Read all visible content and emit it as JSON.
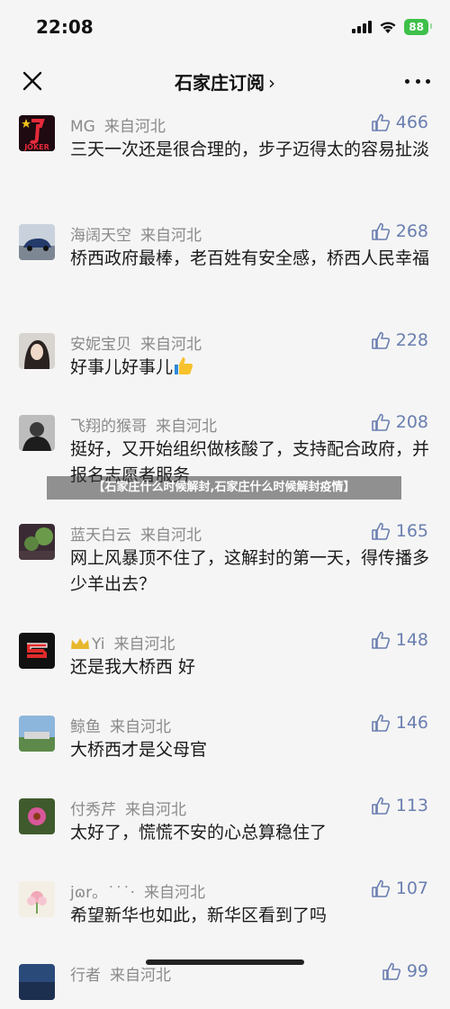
{
  "status_bar": {
    "time": "22:08",
    "battery": "88"
  },
  "navbar": {
    "title": "石家庄订阅",
    "chevron": "›"
  },
  "comments": [
    {
      "user": "MG",
      "location": "来自河北",
      "likes": "466",
      "text": "三天一次还是很合理的，步子迈得太的容易扯淡"
    },
    {
      "user": "海阔天空",
      "location": "来自河北",
      "likes": "268",
      "text": "桥西政府最棒，老百姓有安全感，桥西人民幸福"
    },
    {
      "user": "安妮宝贝",
      "location": "来自河北",
      "likes": "228",
      "text": "好事儿好事儿"
    },
    {
      "user": "飞翔的猴哥",
      "location": "来自河北",
      "likes": "208",
      "text": "挺好，又开始组织做核酸了，支持配合政府，并报名志愿者服务"
    },
    {
      "user": "蓝天白云",
      "location": "来自河北",
      "likes": "165",
      "text": "网上风暴顶不住了，这解封的第一天，得传播多少羊出去？"
    },
    {
      "user": "Yi",
      "location": "来自河北",
      "likes": "148",
      "text": "还是我大桥西 好"
    },
    {
      "user": "鲸鱼",
      "location": "来自河北",
      "likes": "146",
      "text": "大桥西才是父母官"
    },
    {
      "user": "付秀芹",
      "location": "来自河北",
      "likes": "113",
      "text": "太好了，慌慌不安的心总算稳住了"
    },
    {
      "user": "jɷr。˙˙˙·",
      "location": "来自河北",
      "likes": "107",
      "text": "希望新华也如此，新华区看到了吗"
    },
    {
      "user": "行者",
      "location": "来自河北",
      "likes": "99",
      "text": ""
    }
  ],
  "banner": "【石家庄什么时候解封,石家庄什么时候解封疫情】",
  "icons": [
    "close-icon",
    "more-icon",
    "like-icon",
    "signal-icon",
    "wifi-icon",
    "battery-icon"
  ],
  "colors": {
    "like": "#6a7fb0",
    "meta": "#8a8a8a",
    "battery": "#3ec04a"
  }
}
